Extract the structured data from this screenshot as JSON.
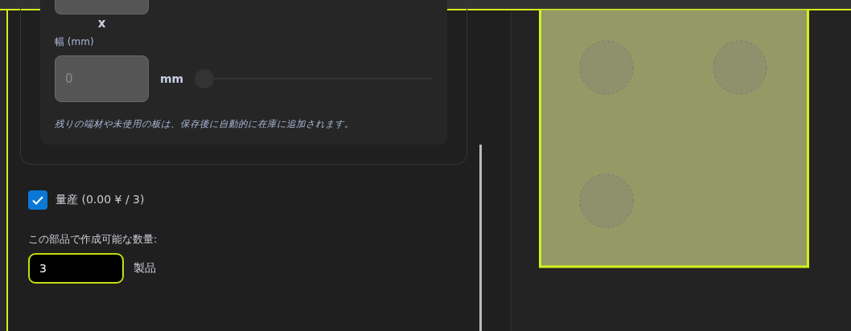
{
  "dimensions": {
    "separator": "x",
    "width_label": "幅 (mm)",
    "width_field": {
      "value": "0",
      "disabled": true
    },
    "width_unit": "mm",
    "width_slider": {
      "level": 0
    },
    "note": "残りの端材や未使用の板は、保存後に自動的に在庫に追加されます。"
  },
  "mass_production": {
    "label": "量産 (0.00 ¥ / 3)",
    "checked": true
  },
  "quantity": {
    "label": "この部品で作成可能な数量:",
    "value": "3",
    "unit": "製品"
  }
}
